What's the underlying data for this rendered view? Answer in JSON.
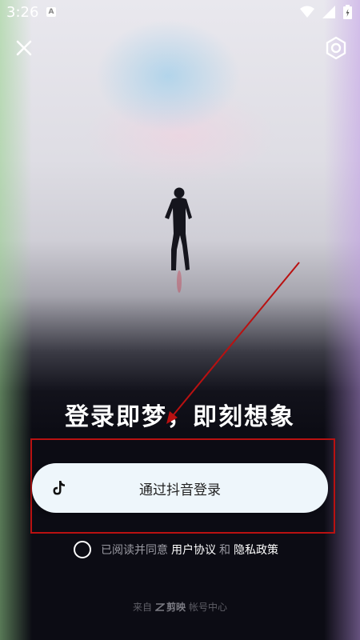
{
  "status_bar": {
    "time": "3:26",
    "notification_icon": "a-icon",
    "icons": [
      "wifi-icon",
      "signal-icon",
      "battery-icon"
    ]
  },
  "top_bar": {
    "close_icon": "close-icon",
    "settings_icon": "settings-icon"
  },
  "hero": {
    "tagline": "登录即梦，即刻想象"
  },
  "login": {
    "button_label": "通过抖音登录",
    "button_icon": "tiktok-icon"
  },
  "agreement": {
    "prefix": "已阅读并同意",
    "user_agreement": "用户协议",
    "and": "和",
    "privacy_policy": "隐私政策"
  },
  "footer": {
    "from": "来自",
    "brand": "剪映",
    "account_center": "帐号中心"
  },
  "colors": {
    "background": "#0c0c14",
    "button_bg": "#eef6fb",
    "annotation": "#b91111"
  }
}
